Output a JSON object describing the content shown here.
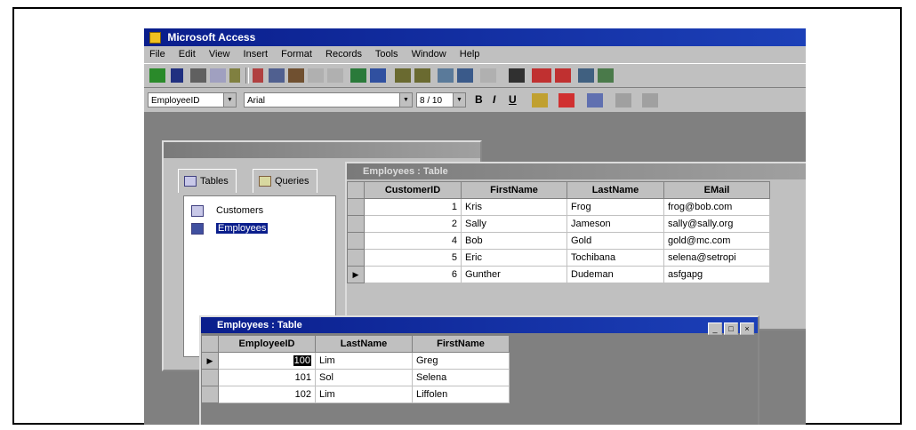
{
  "app": {
    "title": "Microsoft Access"
  },
  "menu": [
    "File",
    "Edit",
    "View",
    "Insert",
    "Format",
    "Records",
    "Tools",
    "Window",
    "Help"
  ],
  "format_bar": {
    "field": "EmployeeID",
    "font": "Arial",
    "size": "8 / 10"
  },
  "db_window": {
    "tabs": [
      "Tables",
      "Queries"
    ],
    "items": [
      {
        "label": "Customers",
        "selected": false
      },
      {
        "label": "Employees",
        "selected": true
      }
    ]
  },
  "customers_table": {
    "title": "Employees : Table",
    "columns": [
      "CustomerID",
      "FirstName",
      "LastName",
      "EMail"
    ],
    "rows": [
      [
        "1",
        "Kris",
        "Frog",
        "frog@bob.com"
      ],
      [
        "2",
        "Sally",
        "Jameson",
        "sally@sally.org"
      ],
      [
        "4",
        "Bob",
        "Gold",
        "gold@mc.com"
      ],
      [
        "5",
        "Eric",
        "Tochibana",
        "selena@setropi"
      ],
      [
        "6",
        "Gunther",
        "Dudeman",
        "asfgapg"
      ]
    ]
  },
  "employees_table": {
    "title": "Employees : Table",
    "columns": [
      "EmployeeID",
      "LastName",
      "FirstName"
    ],
    "rows": [
      [
        "100",
        "Lim",
        "Greg"
      ],
      [
        "101",
        "Sol",
        "Selena"
      ],
      [
        "102",
        "Lim",
        "Liffolen"
      ]
    ]
  },
  "colors": {
    "title_active": "#0a1e8c",
    "chrome": "#c0c0c0",
    "mdi_bg": "#808080"
  }
}
